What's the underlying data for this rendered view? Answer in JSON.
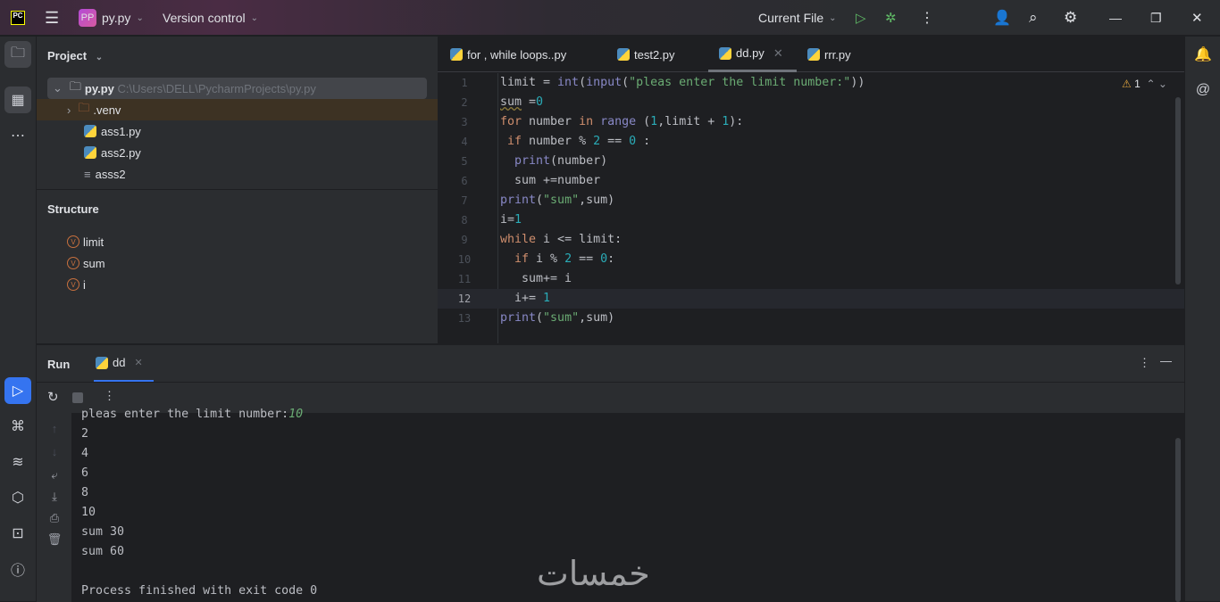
{
  "titlebar": {
    "logo": "PC",
    "project_badge": "PP",
    "project_name": "py.py",
    "vcs": "Version control",
    "run_config": "Current File"
  },
  "project": {
    "title": "Project",
    "tree": [
      {
        "name": "py.py",
        "path": "C:\\Users\\DELL\\PycharmProjects\\py.py",
        "type": "folder",
        "expanded": true
      },
      {
        "name": ".venv",
        "type": "folder-excluded"
      },
      {
        "name": "ass1.py",
        "type": "python"
      },
      {
        "name": "ass2.py",
        "type": "python"
      },
      {
        "name": "asss2",
        "type": "text"
      }
    ]
  },
  "structure": {
    "title": "Structure",
    "items": [
      "limit",
      "sum",
      "i"
    ],
    "badge": "V"
  },
  "editor": {
    "tabs": [
      "for , while loops..py",
      "test2.py",
      "dd.py",
      "rrr.py"
    ],
    "active_tab": 2,
    "warnings": "1",
    "current_line": 12,
    "lines": [
      [
        [
          "limit = ",
          "d"
        ],
        [
          "int",
          "b"
        ],
        [
          "(",
          "d"
        ],
        [
          "input",
          "b"
        ],
        [
          "(",
          "d"
        ],
        [
          "\"pleas enter the limit number:\"",
          "s"
        ],
        [
          "))",
          "d"
        ]
      ],
      [
        [
          "sum",
          "d"
        ],
        [
          " =",
          "d"
        ],
        [
          "0",
          "n"
        ]
      ],
      [
        [
          "for ",
          "k"
        ],
        [
          "number ",
          "d"
        ],
        [
          "in ",
          "k"
        ],
        [
          "range ",
          "b"
        ],
        [
          "(",
          "d"
        ],
        [
          "1",
          "n"
        ],
        [
          ",limit + ",
          "d"
        ],
        [
          "1",
          "n"
        ],
        [
          "):",
          "d"
        ]
      ],
      [
        [
          " if ",
          "k"
        ],
        [
          "number % ",
          "d"
        ],
        [
          "2",
          "n"
        ],
        [
          " == ",
          "d"
        ],
        [
          "0",
          "n"
        ],
        [
          " :",
          "d"
        ]
      ],
      [
        [
          "  ",
          "d"
        ],
        [
          "print",
          "b"
        ],
        [
          "(number)",
          "d"
        ]
      ],
      [
        [
          "  sum +=number",
          "d"
        ]
      ],
      [
        [
          "print",
          "b"
        ],
        [
          "(",
          "d"
        ],
        [
          "\"sum\"",
          "s"
        ],
        [
          ",sum)",
          "d"
        ]
      ],
      [
        [
          "i=",
          "d"
        ],
        [
          "1",
          "n"
        ]
      ],
      [
        [
          "while ",
          "k"
        ],
        [
          "i <= limit:",
          "d"
        ]
      ],
      [
        [
          "  ",
          "d"
        ],
        [
          "if ",
          "k"
        ],
        [
          "i % ",
          "d"
        ],
        [
          "2",
          "n"
        ],
        [
          " == ",
          "d"
        ],
        [
          "0",
          "n"
        ],
        [
          ":",
          "d"
        ]
      ],
      [
        [
          "   sum+= i",
          "d"
        ]
      ],
      [
        [
          "  i+= ",
          "d"
        ],
        [
          "1",
          "n"
        ]
      ],
      [
        [
          "print",
          "b"
        ],
        [
          "(",
          "d"
        ],
        [
          "\"sum\"",
          "s"
        ],
        [
          ",sum)",
          "d"
        ]
      ]
    ]
  },
  "run": {
    "title": "Run",
    "tab": "dd",
    "output": [
      "pleas enter the limit number:",
      "2",
      "4",
      "6",
      "8",
      "10",
      "sum 30",
      "sum 60",
      "",
      "Process finished with exit code 0"
    ],
    "input_value": "10"
  },
  "watermark": "خمسات",
  "colors": {
    "keyword": "#cf8e6d",
    "builtin": "#8888c6",
    "string": "#6aab73",
    "number": "#2aacb8",
    "accent": "#3574f0"
  }
}
